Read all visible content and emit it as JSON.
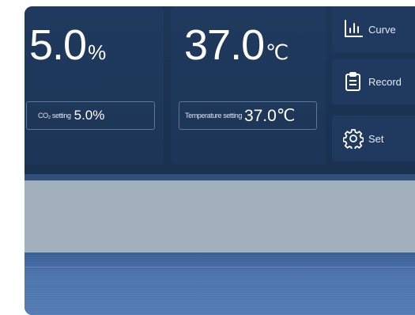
{
  "co2": {
    "value": "5.0",
    "unit": "%",
    "setting_label": "CO₂ setting",
    "setting_value": "5.0%"
  },
  "temperature": {
    "value": "37.0",
    "unit": "℃",
    "setting_label": "Temperature setting",
    "setting_value": "37.0℃"
  },
  "menu": [
    {
      "label": "Curve",
      "icon": "bar-chart-icon"
    },
    {
      "label": "Record",
      "icon": "clipboard-icon"
    },
    {
      "label": "Set",
      "icon": "gear-icon"
    }
  ],
  "colors": {
    "panel_bg": "#1c3658",
    "card_bg": "#1f3a5e",
    "text": "#ffffff",
    "grey_band": "#a2b0bd",
    "blue_band": "#4c73aa"
  }
}
